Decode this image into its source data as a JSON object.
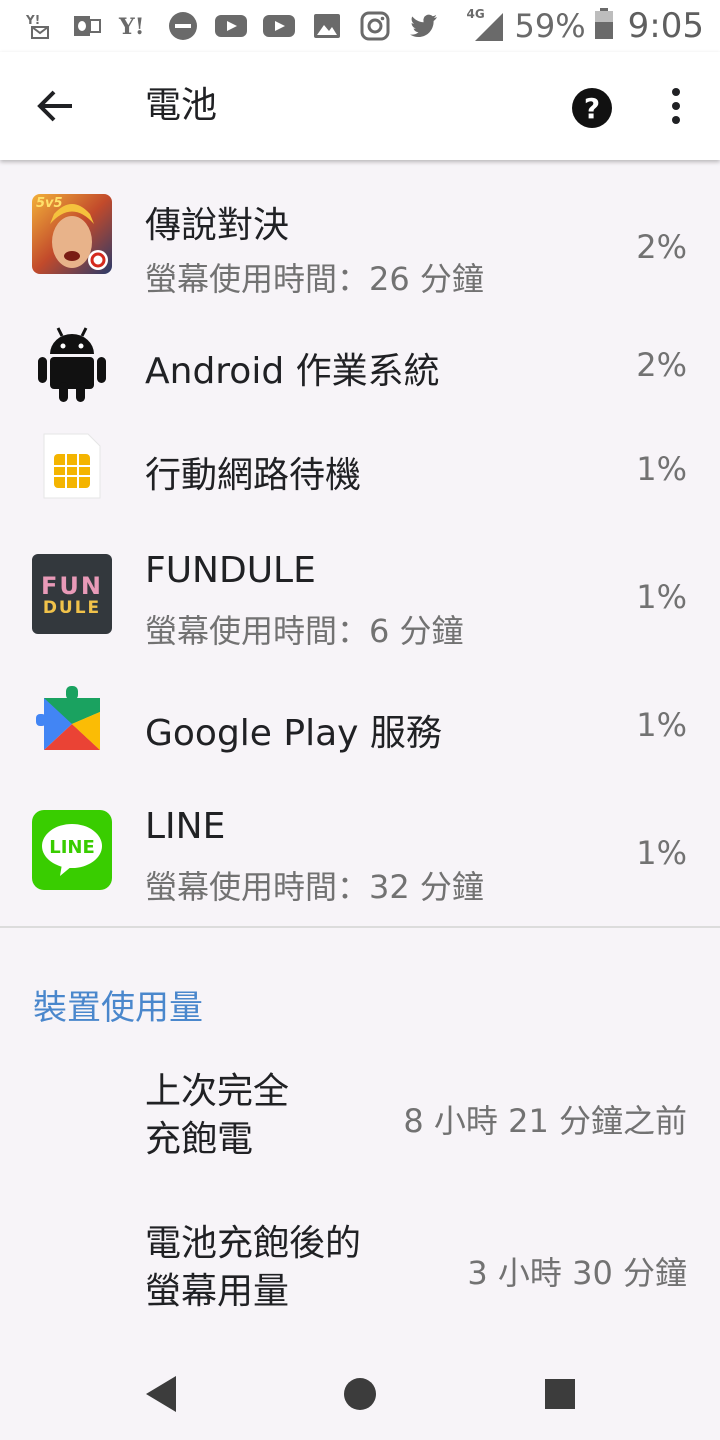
{
  "status_bar": {
    "notification_icons": [
      "yahoo-mail-icon",
      "outlook-icon",
      "yahoo-icon",
      "do-not-disturb-icon",
      "youtube-icon",
      "youtube-icon",
      "gallery-icon",
      "instagram-icon",
      "twitter-icon"
    ],
    "network": "4G",
    "battery": "59%",
    "time": "9:05"
  },
  "app_bar": {
    "title": "電池"
  },
  "apps": [
    {
      "name": "傳說對決",
      "sub": "螢幕使用時間：26 分鐘",
      "pct": "2%"
    },
    {
      "name": "Android 作業系統",
      "sub": "",
      "pct": "2%"
    },
    {
      "name": "行動網路待機",
      "sub": "",
      "pct": "1%"
    },
    {
      "name": "FUNDULE",
      "sub": "螢幕使用時間：6 分鐘",
      "pct": "1%"
    },
    {
      "name": "Google Play 服務",
      "sub": "",
      "pct": "1%"
    },
    {
      "name": "LINE",
      "sub": "螢幕使用時間：32 分鐘",
      "pct": "1%"
    }
  ],
  "icon_text": {
    "aov_badge": "5v5",
    "fundule_top": "FUN",
    "fundule_bottom": "DULE",
    "line": "LINE"
  },
  "device_usage": {
    "title": "裝置使用量",
    "last_full_charge_label_1": "上次完全",
    "last_full_charge_label_2": "充飽電",
    "last_full_charge_value": "8 小時 21 分鐘之前",
    "screen_usage_label_1": "電池充飽後的",
    "screen_usage_label_2": "螢幕用量",
    "screen_usage_value": "3 小時 30 分鐘"
  },
  "colors": {
    "accent": "#4a87cc",
    "background": "#f7f4f8",
    "line_green": "#39cd00"
  }
}
